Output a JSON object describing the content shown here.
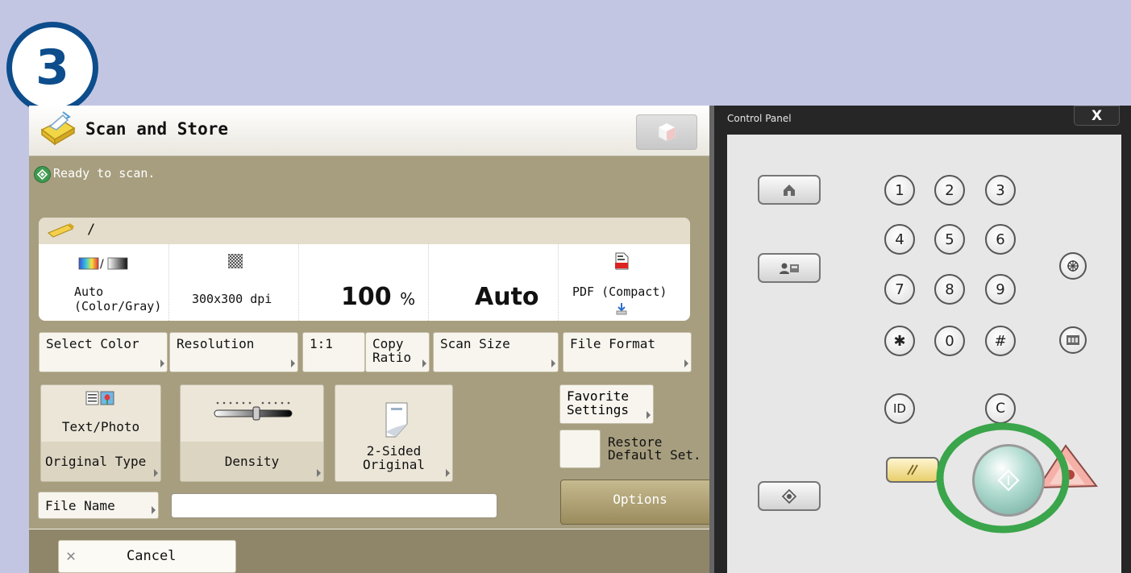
{
  "step_number": "3",
  "app": {
    "title": "Scan and Store",
    "status": "Ready to scan."
  },
  "summary": {
    "path_separator": "/",
    "color_mode": "Auto\n(Color/Gray)",
    "resolution": "300x300 dpi",
    "ratio_value": "100",
    "ratio_unit": "%",
    "scan_size": "Auto",
    "file_format": "PDF (Compact)"
  },
  "setting_buttons": {
    "select_color": "Select Color",
    "resolution": "Resolution",
    "ratio_1to1": "1:1",
    "copy_ratio": "Copy\nRatio",
    "scan_size": "Scan Size",
    "file_format": "File Format"
  },
  "function_buttons": {
    "original_type_value": "Text/Photo",
    "original_type": "Original Type",
    "density": "Density",
    "two_sided": "2-Sided\nOriginal"
  },
  "favorite_settings": "Favorite\nSettings",
  "restore_default": "Restore\nDefault Set.",
  "options": "Options",
  "file_name": {
    "label": "File Name",
    "value": ""
  },
  "cancel": "Cancel",
  "control_panel": {
    "title": "Control Panel",
    "close": "X",
    "keys": [
      "1",
      "2",
      "3",
      "4",
      "5",
      "6",
      "7",
      "8",
      "9",
      "✱",
      "0",
      "#"
    ],
    "id_key": "ID",
    "clear_key": "C",
    "highlight_color": "#3aa54a"
  }
}
